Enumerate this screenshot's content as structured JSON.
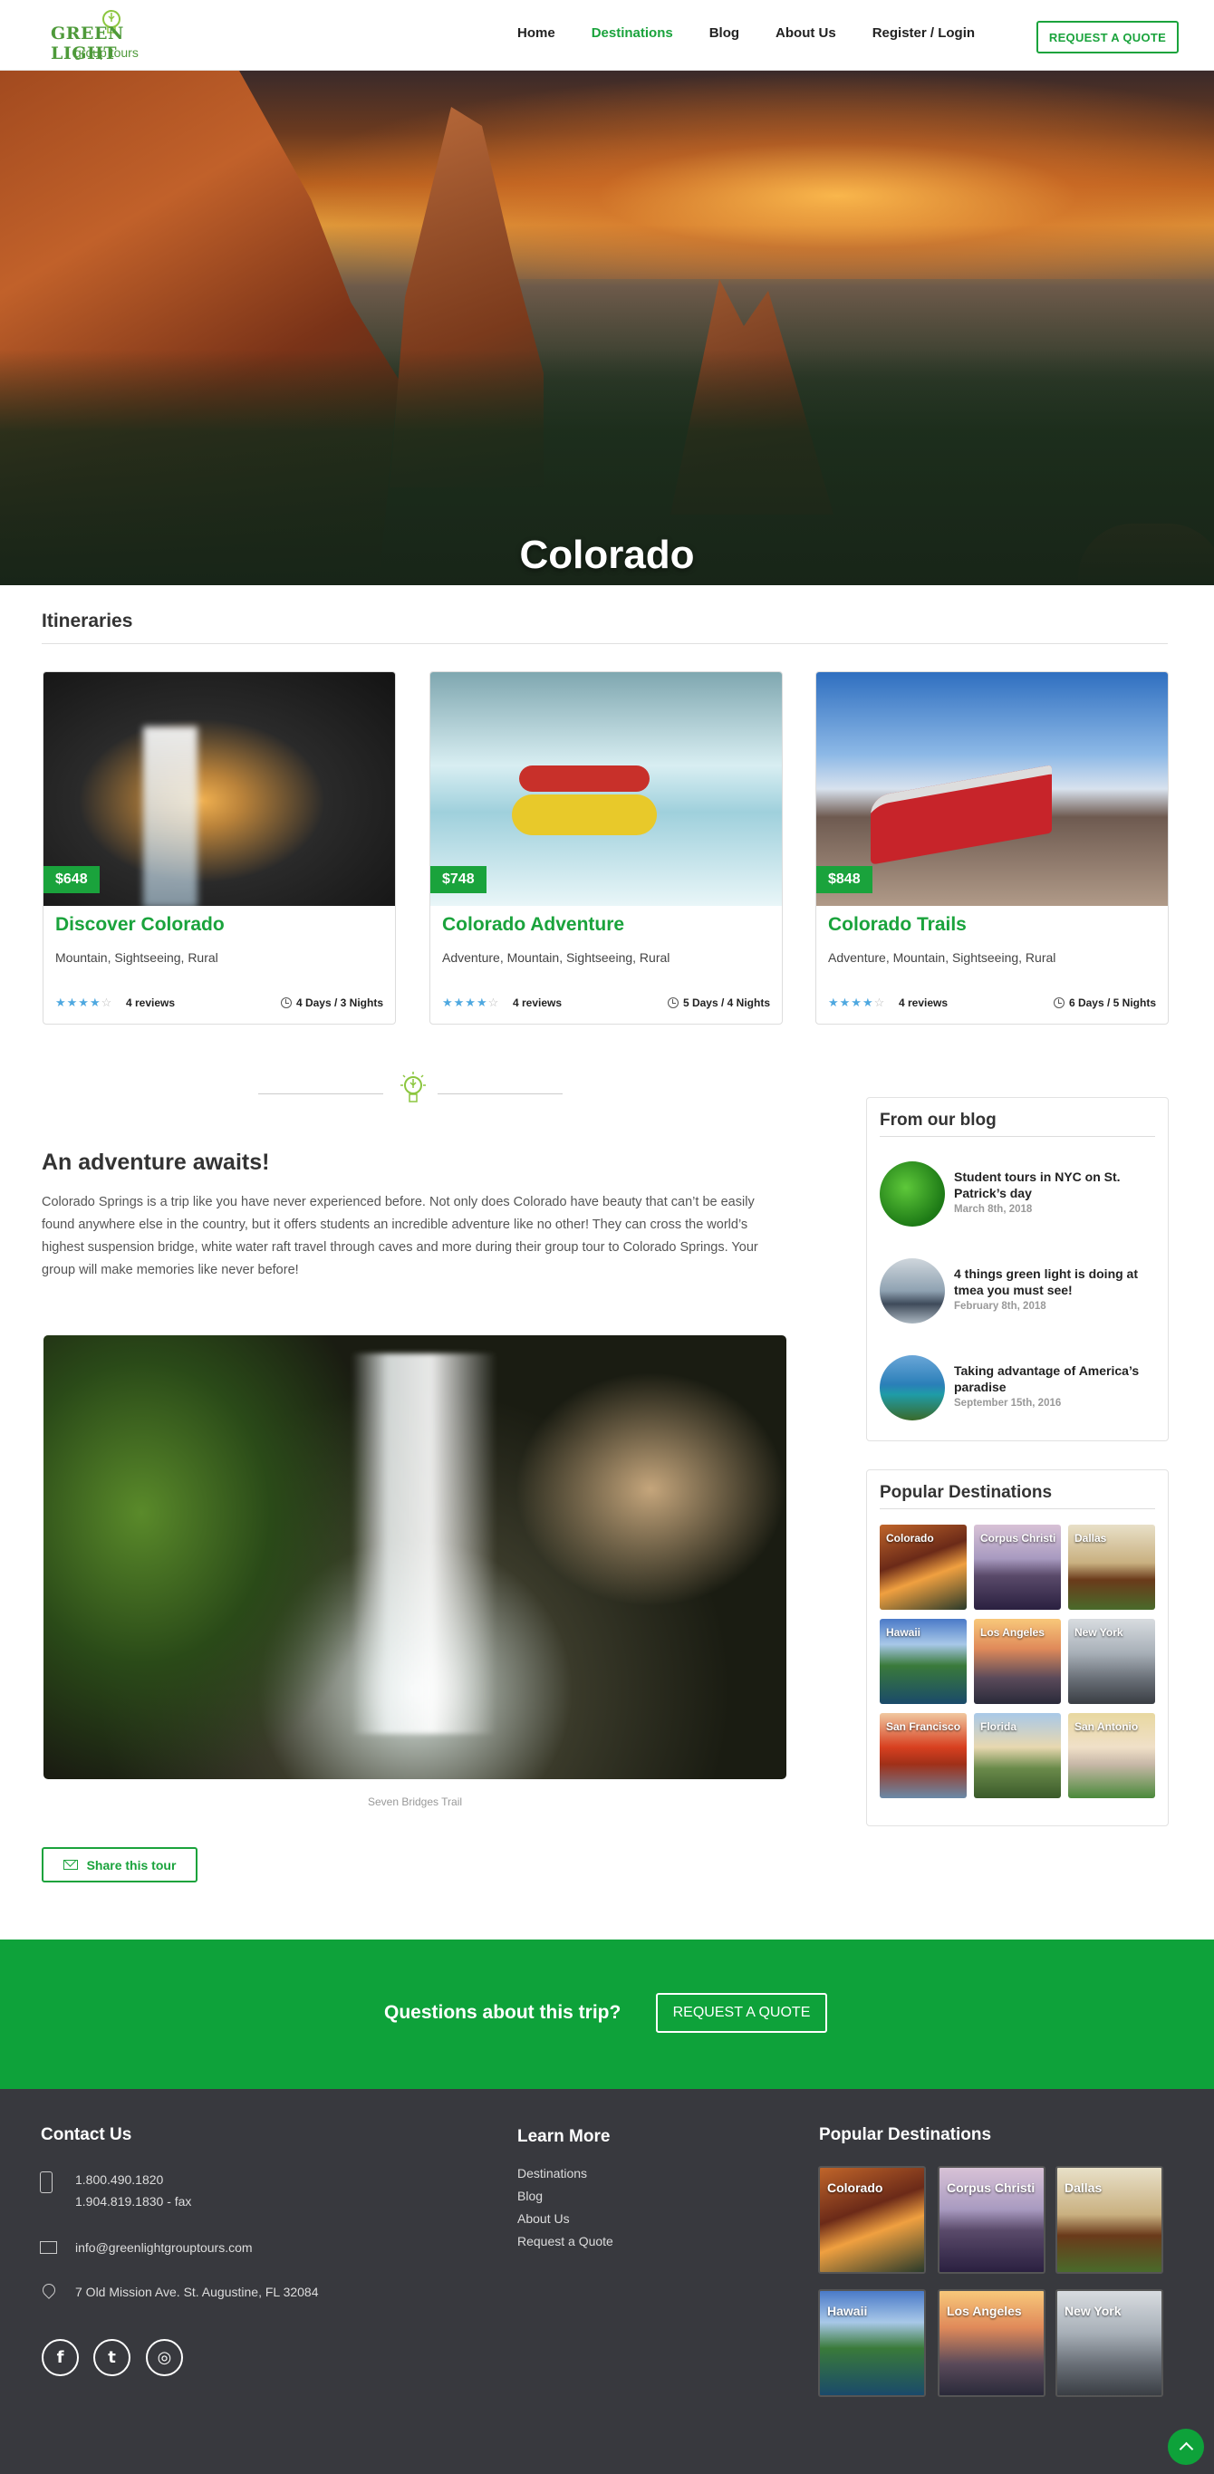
{
  "brand": {
    "line1": "GREEN LIGHT",
    "line2": "group tours",
    "accent": "#1aa33c",
    "footer_bg": "#38393e"
  },
  "nav": {
    "items": [
      {
        "label": "Home"
      },
      {
        "label": "Destinations",
        "active": true
      },
      {
        "label": "Blog"
      },
      {
        "label": "About Us"
      },
      {
        "label": "Register / Login"
      }
    ],
    "quote_button": "REQUEST A QUOTE"
  },
  "hero": {
    "title": "Colorado"
  },
  "itineraries": {
    "heading": "Itineraries",
    "cards": [
      {
        "price": "$648",
        "title": "Discover Colorado",
        "tags": "Mountain, Sightseeing, Rural",
        "rating": 4,
        "reviews": "4 reviews",
        "duration": "4 Days / 3 Nights",
        "image": "cave-waterfall"
      },
      {
        "price": "$748",
        "title": "Colorado Adventure",
        "tags": "Adventure, Mountain, Sightseeing, Rural",
        "rating": 4,
        "reviews": "4 reviews",
        "duration": "5 Days / 4 Nights",
        "image": "white-water-rafting"
      },
      {
        "price": "$848",
        "title": "Colorado Trails",
        "tags": "Adventure, Mountain, Sightseeing, Rural",
        "rating": 4,
        "reviews": "4 reviews",
        "duration": "6 Days / 5 Nights",
        "image": "mountain-train"
      }
    ]
  },
  "adventure": {
    "title": "An adventure awaits!",
    "text": "Colorado Springs is a trip like you have never experienced before. Not only does Colorado have beauty that can’t be easily found anywhere else in the country, but it offers students an incredible adventure like no other! They can cross the world’s highest suspension bridge, white water raft travel through caves and more during their group tour to Colorado Springs. Your group will make memories like never before!",
    "image_caption": "Seven Bridges Trail",
    "share_label": "Share this tour"
  },
  "blog": {
    "heading": "From our blog",
    "posts": [
      {
        "title": "Student tours in NYC on St. Patrick’s day",
        "date": "March 8th, 2018"
      },
      {
        "title": "4 things green light is doing at tmea you must see!",
        "date": "February 8th, 2018"
      },
      {
        "title": "Taking advantage of America’s paradise",
        "date": "September 15th, 2016"
      }
    ]
  },
  "popular": {
    "heading": "Popular Destinations",
    "items": [
      "Colorado",
      "Corpus Christi",
      "Dallas",
      "Hawaii",
      "Los Angeles",
      "New York",
      "San Francisco",
      "Florida",
      "San Antonio"
    ]
  },
  "cta": {
    "question": "Questions about this trip?",
    "button": "REQUEST A QUOTE"
  },
  "footer": {
    "contact": {
      "heading": "Contact Us",
      "phone": "1.800.490.1820",
      "fax": "1.904.819.1830 - fax",
      "email": "info@greenlightgrouptours.com",
      "address": "7 Old Mission Ave. St. Augustine, FL 32084"
    },
    "learn": {
      "heading": "Learn More",
      "links": [
        "Destinations",
        "Blog",
        "About Us",
        "Request a Quote"
      ]
    },
    "popular": {
      "heading": "Popular Destinations",
      "items": [
        "Colorado",
        "Corpus Christi",
        "Dallas",
        "Hawaii",
        "Los Angeles",
        "New York"
      ]
    },
    "social": [
      "facebook-icon",
      "twitter-icon",
      "instagram-icon"
    ]
  }
}
